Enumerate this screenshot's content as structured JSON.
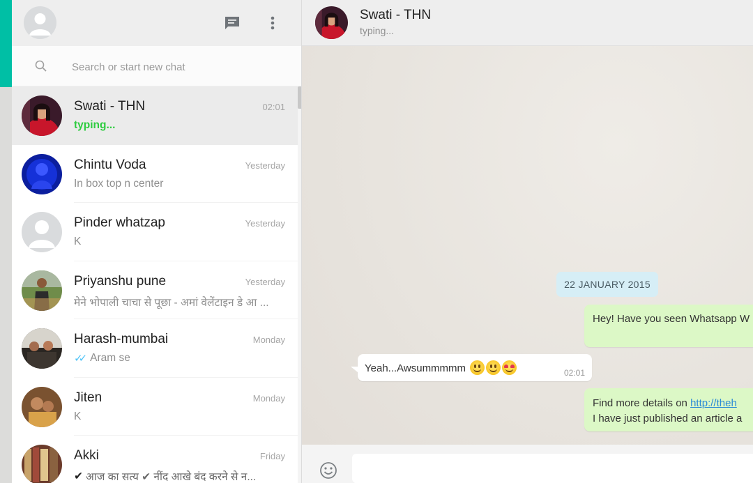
{
  "sidebar": {
    "search": {
      "placeholder": "Search or start new chat",
      "value": ""
    },
    "chats": [
      {
        "name": "Swati - THN",
        "time": "02:01",
        "preview": "typing...",
        "active": true
      },
      {
        "name": "Chintu Voda",
        "time": "Yesterday",
        "preview": "In box top n center"
      },
      {
        "name": "Pinder whatzap",
        "time": "Yesterday",
        "preview": "K"
      },
      {
        "name": "Priyanshu pune",
        "time": "Yesterday",
        "preview": "मेने भोपाली चाचा से पूछा - अमां वेलेंटाइन डे आ ..."
      },
      {
        "name": "Harash-mumbai",
        "time": "Monday",
        "preview": "Aram se",
        "ticks": "✓✓"
      },
      {
        "name": "Jiten",
        "time": "Monday",
        "preview": "K"
      },
      {
        "name": "Akki",
        "time": "Friday",
        "preview": "आज का सत्य ✔ नींद आखे बंद करने से न...",
        "check": "✔"
      }
    ]
  },
  "conversation": {
    "title": "Swati - THN",
    "status": "typing...",
    "date_chip": "22 JANUARY 2015",
    "messages": {
      "m1": {
        "text": "Hey! Have you seen Whatsapp W"
      },
      "m2": {
        "text": "Yeah...Awsummmmm",
        "time": "02:01"
      },
      "m3": {
        "line1_prefix": "Find more details on ",
        "link": "http://theh",
        "line2": "I have just published an article a"
      }
    },
    "compose": {
      "placeholder": "",
      "value": ""
    }
  },
  "colors": {
    "accent": "#00bfa5",
    "typing": "#2ecc40",
    "outgoing_bubble": "#dcf8c6",
    "date_chip": "#d6eef6",
    "read_ticks": "#4fc3f7"
  },
  "icons": {
    "header": [
      "chat-icon",
      "menu-icon"
    ],
    "search": "search-icon",
    "compose": "emoji-icon"
  }
}
